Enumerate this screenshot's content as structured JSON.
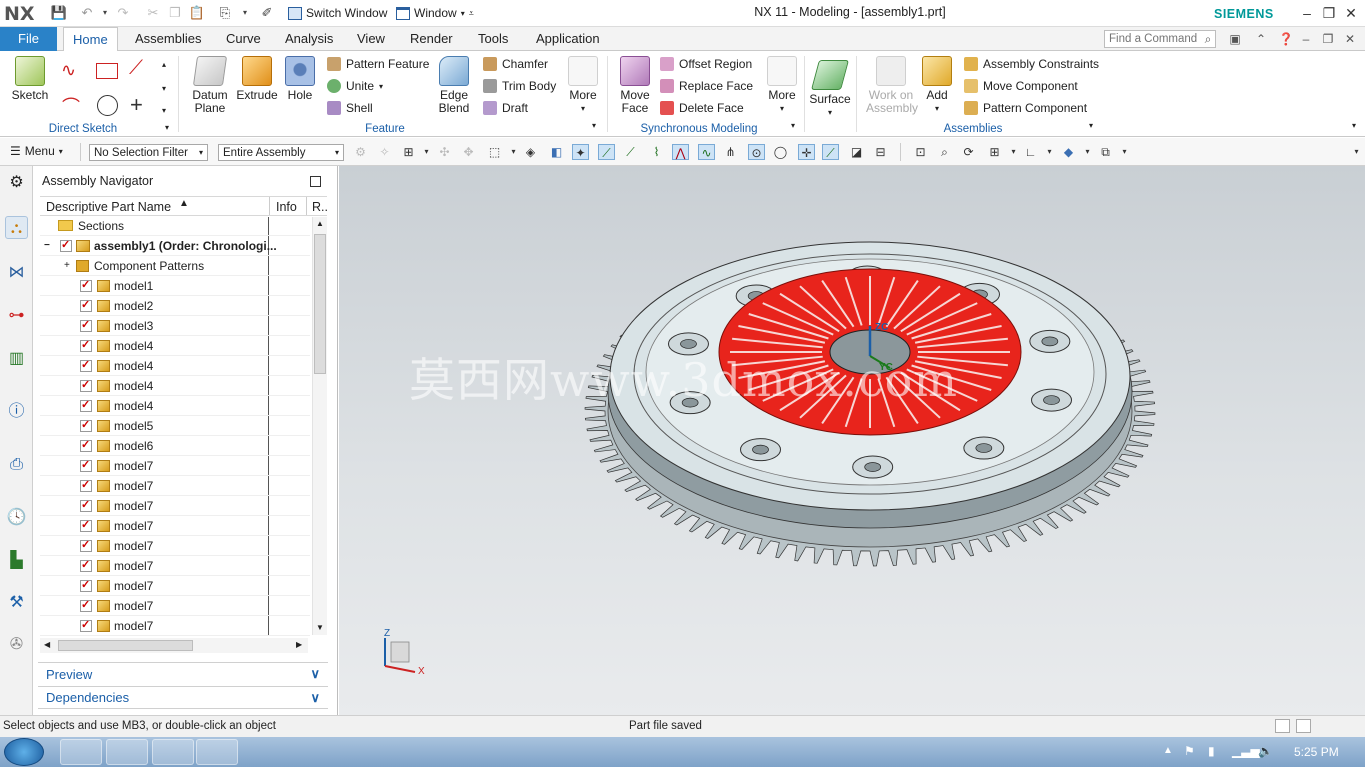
{
  "app": {
    "logo": "NX",
    "title": "NX 11 - Modeling - [assembly1.prt]",
    "brand": "SIEMENS",
    "switch_window": "Switch Window",
    "window_menu": "Window"
  },
  "tabs": {
    "file": "File",
    "items": [
      "Home",
      "Assemblies",
      "Curve",
      "Analysis",
      "View",
      "Render",
      "Tools",
      "Application"
    ],
    "active": "Home"
  },
  "search": {
    "placeholder": "Find a Command"
  },
  "ribbon": {
    "direct_sketch": {
      "sketch": "Sketch",
      "label": "Direct Sketch"
    },
    "feature": {
      "datum_plane": "Datum Plane",
      "extrude": "Extrude",
      "hole": "Hole",
      "pattern_feature": "Pattern Feature",
      "unite": "Unite",
      "shell": "Shell",
      "edge_blend": "Edge Blend",
      "chamfer": "Chamfer",
      "trim_body": "Trim Body",
      "draft": "Draft",
      "more": "More",
      "label": "Feature"
    },
    "sync": {
      "move_face": "Move Face",
      "offset_region": "Offset Region",
      "replace_face": "Replace Face",
      "delete_face": "Delete Face",
      "more": "More",
      "label": "Synchronous Modeling"
    },
    "surface": "Surface",
    "assemblies": {
      "work_on_assembly": "Work on Assembly",
      "add": "Add",
      "constraints": "Assembly Constraints",
      "move_component": "Move Component",
      "pattern_component": "Pattern Component",
      "label": "Assemblies"
    }
  },
  "selbar": {
    "menu": "Menu",
    "filter": "No Selection Filter",
    "scope": "Entire Assembly"
  },
  "navigator": {
    "title": "Assembly Navigator",
    "columns": [
      "Descriptive Part Name",
      "Info",
      "R.."
    ],
    "sections": "Sections",
    "root": "assembly1 (Order: Chronologi...",
    "component_patterns": "Component Patterns",
    "models": [
      "model1",
      "model2",
      "model3",
      "model4",
      "model4",
      "model4",
      "model4",
      "model5",
      "model6",
      "model7",
      "model7",
      "model7",
      "model7",
      "model7",
      "model7",
      "model7",
      "model7",
      "model7"
    ],
    "preview": "Preview",
    "dependencies": "Dependencies"
  },
  "viewport": {
    "watermark": "莫西网www.3dmox.com",
    "axis_zc": "ZC",
    "axis_yc": "YC",
    "axis_z": "Z",
    "axis_x": "X"
  },
  "status": {
    "left": "Select objects and use MB3, or double-click an object",
    "center": "Part file saved"
  },
  "taskbar": {
    "clock": "5:25 PM"
  },
  "colors": {
    "accent": "#1b5fa8",
    "file_tab": "#2a82c8",
    "brand": "#009999",
    "clutch_red": "#e8241c"
  }
}
